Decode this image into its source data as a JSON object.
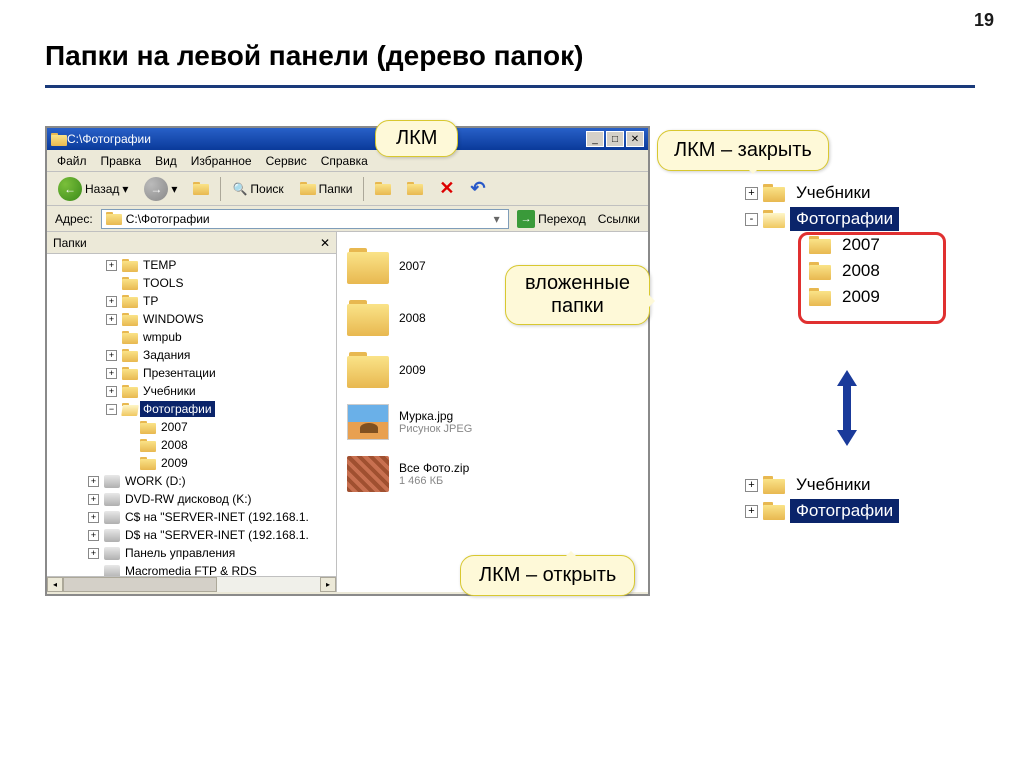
{
  "page_number": "19",
  "title": "Папки на левой панели (дерево папок)",
  "window": {
    "title": "C:\\Фотографии",
    "menu": {
      "file": "Файл",
      "edit": "Правка",
      "view": "Вид",
      "favorites": "Избранное",
      "tools": "Сервис",
      "help": "Справка"
    },
    "toolbar": {
      "back": "Назад",
      "search": "Поиск",
      "folders": "Папки"
    },
    "address": {
      "label": "Адрес:",
      "value": "C:\\Фотографии",
      "go": "Переход",
      "links": "Ссылки"
    },
    "tree_header": "Папки",
    "tree": [
      {
        "indent": 0,
        "exp": "+",
        "icon": "folder",
        "label": "TEMP"
      },
      {
        "indent": 0,
        "exp": "",
        "icon": "folder",
        "label": "TOOLS"
      },
      {
        "indent": 0,
        "exp": "+",
        "icon": "folder",
        "label": "TP"
      },
      {
        "indent": 0,
        "exp": "+",
        "icon": "folder",
        "label": "WINDOWS"
      },
      {
        "indent": 0,
        "exp": "",
        "icon": "folder",
        "label": "wmpub"
      },
      {
        "indent": 0,
        "exp": "+",
        "icon": "folder",
        "label": "Задания"
      },
      {
        "indent": 0,
        "exp": "+",
        "icon": "folder",
        "label": "Презентации"
      },
      {
        "indent": 0,
        "exp": "+",
        "icon": "folder",
        "label": "Учебники"
      },
      {
        "indent": 0,
        "exp": "-",
        "icon": "folder-open",
        "label": "Фотографии",
        "selected": true
      },
      {
        "indent": 1,
        "exp": "",
        "icon": "folder",
        "label": "2007"
      },
      {
        "indent": 1,
        "exp": "",
        "icon": "folder",
        "label": "2008"
      },
      {
        "indent": 1,
        "exp": "",
        "icon": "folder",
        "label": "2009"
      },
      {
        "indent": -1,
        "exp": "+",
        "icon": "drive",
        "label": "WORK (D:)"
      },
      {
        "indent": -1,
        "exp": "+",
        "icon": "drive",
        "label": "DVD-RW дисковод (K:)"
      },
      {
        "indent": -1,
        "exp": "+",
        "icon": "drive",
        "label": "C$ на \"SERVER-INET (192.168.1."
      },
      {
        "indent": -1,
        "exp": "+",
        "icon": "drive",
        "label": "D$ на \"SERVER-INET (192.168.1."
      },
      {
        "indent": -1,
        "exp": "+",
        "icon": "drive",
        "label": "Панель управления"
      },
      {
        "indent": -1,
        "exp": "",
        "icon": "drive",
        "label": "Macromedia FTP & RDS"
      }
    ],
    "content": {
      "f1": "2007",
      "f2": "2008",
      "f3": "2009",
      "img": {
        "name": "Мурка.jpg",
        "type": "Рисунок JPEG"
      },
      "zip": {
        "name": "Все Фото.zip",
        "size": "1 466 КБ"
      }
    }
  },
  "callouts": {
    "lkm": "ЛКМ",
    "close": "ЛКМ – закрыть",
    "nested_l1": "вложенные",
    "nested_l2": "папки",
    "open": "ЛКМ – открыть"
  },
  "right_top": {
    "r1": {
      "exp": "+",
      "label": "Учебники"
    },
    "r2": {
      "exp": "-",
      "label": "Фотографии"
    },
    "c1": "2007",
    "c2": "2008",
    "c3": "2009"
  },
  "right_bot": {
    "r1": {
      "exp": "+",
      "label": "Учебники"
    },
    "r2": {
      "exp": "+",
      "label": "Фотографии"
    }
  }
}
